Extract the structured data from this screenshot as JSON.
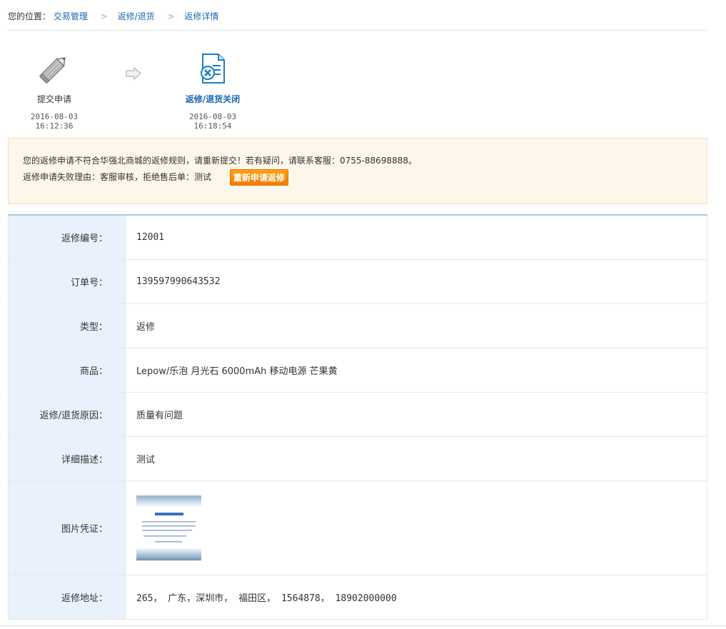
{
  "breadcrumb": {
    "prefix": "您的位置：",
    "items": [
      "交易管理",
      "返修/退货",
      "返修详情"
    ],
    "sep": ">"
  },
  "steps": [
    {
      "label": "提交申请",
      "time": "2016-08-03 16:12:36",
      "icon": "pencil-icon"
    },
    {
      "label": "返修/退货关闭",
      "time": "2016-08-03 16:18:54",
      "icon": "document-cancel-icon"
    }
  ],
  "notice": {
    "line1": "您的返修申请不符合华强北商城的返修规则，请重新提交！若有疑问，请联系客服：0755-88698888。",
    "line2": "返修申请失败理由：客服审核，拒绝售后单：测试",
    "button": "重新申请返修"
  },
  "detail": {
    "rows": [
      {
        "key": "返修编号：",
        "value": "12001"
      },
      {
        "key": "订单号：",
        "value": "139597990643532"
      },
      {
        "key": "类型：",
        "value": "返修"
      },
      {
        "key": "商品：",
        "value": "Lepow/乐泡 月光石 6000mAh 移动电源 芒果黄"
      },
      {
        "key": "返修/退货原因：",
        "value": "质量有问题"
      },
      {
        "key": "详细描述：",
        "value": "测试"
      },
      {
        "key": "图片凭证：",
        "value": ""
      },
      {
        "key": "返修地址：",
        "value": "265， 广东，深圳市， 福田区， 1564878， 18902000000"
      }
    ]
  },
  "colors": {
    "link": "#1a66b3",
    "notice_bg": "#fdf6ea",
    "button": "#f07b00",
    "key_bg": "#e9f2fc"
  }
}
